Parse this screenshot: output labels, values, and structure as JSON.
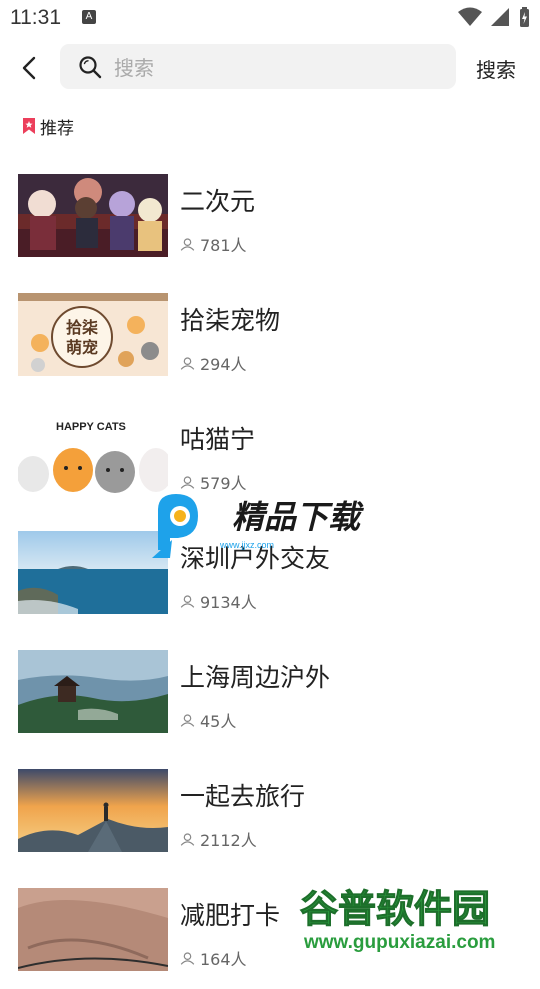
{
  "status_bar": {
    "time": "11:31",
    "notification_icon": "A"
  },
  "header": {
    "search_placeholder": "搜索",
    "search_button": "搜索"
  },
  "section": {
    "label": "推荐"
  },
  "groups": [
    {
      "title": "二次元",
      "members": "781人",
      "thumb": "anime-art"
    },
    {
      "title": "拾柒宠物",
      "members": "294人",
      "thumb": "pet-cartoon"
    },
    {
      "title": "咕猫宁",
      "members": "579人",
      "thumb": "happy-cats",
      "thumb_text": "HAPPY CATS"
    },
    {
      "title": "深圳户外交友",
      "members": "9134人",
      "thumb": "sea-coast"
    },
    {
      "title": "上海周边沪外",
      "members": "45人",
      "thumb": "mountain-pavilion"
    },
    {
      "title": "一起去旅行",
      "members": "2112人",
      "thumb": "sunset-peak"
    },
    {
      "title": "减肥打卡",
      "members": "164人",
      "thumb": "bed-sheet"
    }
  ],
  "watermarks": {
    "top": {
      "title": "精品下载",
      "url": "www.jjxz.com"
    },
    "bottom": {
      "title": "谷普软件园",
      "url": "www.gupuxiazai.com"
    }
  },
  "colors": {
    "accent_bookmark": "#ec3f5b",
    "search_bg": "#f2f2f2",
    "watermark_blue": "#1ea2ea",
    "watermark_green": "#2a9d3e"
  }
}
